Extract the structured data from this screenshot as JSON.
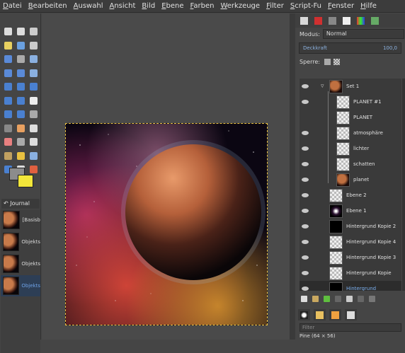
{
  "menu": [
    "Datei",
    "Bearbeiten",
    "Auswahl",
    "Ansicht",
    "Bild",
    "Ebene",
    "Farben",
    "Werkzeuge",
    "Filter",
    "Script-Fu",
    "Fenster",
    "Hilfe"
  ],
  "toolbox": {
    "tools": [
      "rect-select",
      "ellipse-select",
      "free-select",
      "fuzzy-select",
      "color-select",
      "scissors-select",
      "paths",
      "color-picker",
      "zoom",
      "move",
      "align",
      "crop",
      "rotate",
      "scale",
      "shear",
      "perspective",
      "flip",
      "text",
      "cage",
      "unified",
      "measure",
      "blend",
      "pencil",
      "paintbrush",
      "eraser",
      "airbrush",
      "ink",
      "clone",
      "heal",
      "perspective-clone",
      "bucket-fill",
      "smudge",
      "dodge-burn"
    ],
    "fg_color": "#8c8c8c",
    "bg_color": "#f2e63a"
  },
  "journal": {
    "tab_label": "Journal",
    "items": [
      "[Basisb",
      "Objekts",
      "Objekts",
      "Objekts"
    ],
    "selected_index": 3
  },
  "layers_panel": {
    "mode_label": "Modus:",
    "mode_value": "Normal",
    "opacity_label": "Deckkraft",
    "opacity_value": "100,0",
    "lock_label": "Sperre:",
    "layers": [
      {
        "name": "Set 1",
        "visible": true,
        "group": true,
        "indent": 0
      },
      {
        "name": "PLANET #1",
        "visible": true,
        "indent": 1
      },
      {
        "name": "PLANET",
        "visible": false,
        "indent": 1
      },
      {
        "name": "atmosphäre",
        "visible": true,
        "indent": 1
      },
      {
        "name": "lichter",
        "visible": true,
        "indent": 1
      },
      {
        "name": "schatten",
        "visible": true,
        "indent": 1
      },
      {
        "name": "planet",
        "visible": true,
        "indent": 1
      },
      {
        "name": "Ebene 2",
        "visible": true,
        "indent": 0
      },
      {
        "name": "Ebene 1",
        "visible": true,
        "indent": 0
      },
      {
        "name": "Hintergrund Kopie 2",
        "visible": true,
        "indent": 0
      },
      {
        "name": "Hintergrund Kopie 4",
        "visible": true,
        "indent": 0
      },
      {
        "name": "Hintergrund Kopie 3",
        "visible": true,
        "indent": 0
      },
      {
        "name": "Hintergrund Kopie",
        "visible": true,
        "indent": 0
      },
      {
        "name": "Hintergrund",
        "visible": true,
        "indent": 0,
        "selected": true
      }
    ]
  },
  "brushes": {
    "filter_placeholder": "Filter",
    "brush_name": "Pine (64 × 56)"
  }
}
